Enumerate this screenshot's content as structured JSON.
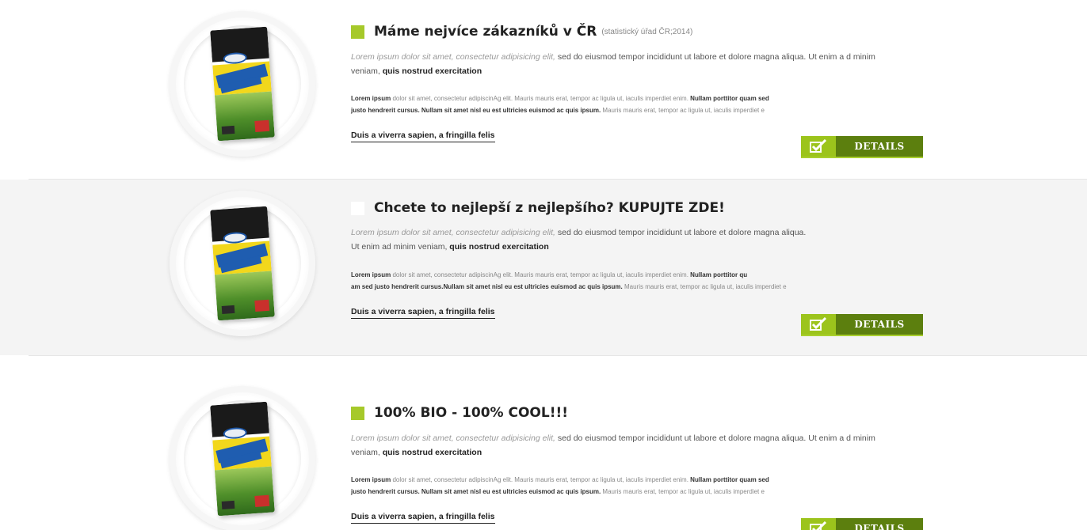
{
  "items": [
    {
      "title": "Máme nejvíce zákazníků v ČR",
      "title_note": "(statistický úřad ČR;2014)",
      "lead_italic": "Lorem ipsum dolor sit amet, consectetur adipisicing elit,",
      "lead_text": " sed do eiusmod tempor incididunt ut labore et dolore magna aliqua. Ut enim a d minim veniam, ",
      "lead_bold": "quis nostrud exercitation",
      "small_line1_bold1": "Lorem ipsum",
      "small_line1_text": " dolor sit amet, consectetur adipiscinAg elit. Mauris mauris erat, tempor ac ligula ut,  iaculis imperdiet enim. ",
      "small_line1_bold2": "Nullam porttitor quam sed",
      "small_line2_bold": "justo hendrerit cursus. Nullam sit amet nisl eu est ultricies euismod ac quis ipsum.",
      "small_line2_text": " Mauris mauris erat, tempor ac ligula ut,  iaculis imperdiet e",
      "link": "Duis a viverra sapien, a fringilla felis",
      "button": "DETAILS"
    },
    {
      "title": "Chcete to nejlepší z nejlepšího? KUPUJTE ZDE!",
      "title_note": "",
      "lead_italic": "Lorem ipsum dolor sit amet, consectetur adipisicing elit,",
      "lead_text": " sed do eiusmod tempor incididunt ut labore et dolore magna aliqua.",
      "lead_line2_text": " Ut enim ad minim veniam, ",
      "lead_bold": "quis nostrud exercitation",
      "small_line1_bold1": "Lorem ipsum",
      "small_line1_text": " dolor sit amet, consectetur adipiscinAg elit. Mauris mauris erat, tempor ac ligula ut,  iaculis imperdiet enim. ",
      "small_line1_bold2": "Nullam porttitor qu",
      "small_line2_bold": "am sed justo hendrerit cursus.Nullam sit amet nisl eu est ultricies euismod ac quis ipsum.",
      "small_line2_text": " Mauris mauris erat, tempor ac ligula ut,  iaculis imperdiet e",
      "link": "Duis a viverra sapien, a fringilla felis",
      "button": "DETAILS"
    },
    {
      "title": "100% BIO - 100% COOL!!!",
      "title_note": "",
      "lead_italic": "Lorem ipsum dolor sit amet, consectetur adipisicing elit,",
      "lead_text": " sed do eiusmod tempor incididunt ut labore et dolore magna aliqua. Ut enim a d minim veniam, ",
      "lead_bold": "quis nostrud exercitation",
      "small_line1_bold1": "Lorem ipsum",
      "small_line1_text": " dolor sit amet, consectetur adipiscinAg elit. Mauris mauris erat, tempor ac ligula ut,  iaculis imperdiet enim. ",
      "small_line1_bold2": "Nullam porttitor quam sed",
      "small_line2_bold": "justo hendrerit cursus. Nullam sit amet nisl eu est ultricies euismod ac quis ipsum.",
      "small_line2_text": " Mauris mauris erat, tempor ac ligula ut,  iaculis imperdiet e",
      "link": "Duis a viverra sapien, a fringilla felis",
      "button": "DETAILS"
    }
  ],
  "colors": {
    "accent_green": "#a6c92a",
    "button_dark": "#5c7f0e",
    "button_light": "#9cc41c"
  },
  "icons": {
    "bullet": "square-bullet-icon",
    "button": "checkbox-check-icon",
    "product": "fertilizer-bag-image"
  }
}
